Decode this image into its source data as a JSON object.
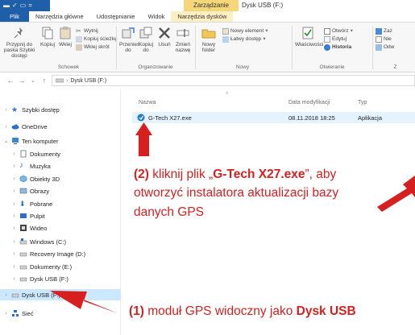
{
  "titlebar": {
    "qat_items": [
      "▬",
      "✓",
      "▭",
      "="
    ],
    "context_tab": "Zarządzanie",
    "window_title": "Dysk USB (F:)"
  },
  "tabs": [
    "Plik",
    "Narzędzia główne",
    "Udostępnianie",
    "Widok",
    "Narzędzia dysków"
  ],
  "ribbon": {
    "pin_label": "Przypnij do paska Szybki dostęp",
    "copy_label": "Kopiuj",
    "paste_label": "Wklej",
    "cut_label": "Wytnij",
    "copy_path_label": "Kopiuj ścieżkę",
    "paste_shortcut_label": "Wklej skrót",
    "move_to_label": "Przenieś do",
    "copy_to_label": "Kopiuj do",
    "delete_label": "Usuń",
    "rename_label": "Zmień nazwę",
    "new_folder_label": "Nowy folder",
    "new_item_label": "Nowy element",
    "easy_access_label": "Łatwy dostęp",
    "properties_label": "Właściwości",
    "open_label": "Otwórz",
    "edit_label": "Edytuj",
    "history_label": "Historia",
    "cut_off_1": "Zaz",
    "cut_off_2": "Nie",
    "cut_off_3": "Odw",
    "groups": [
      "Schowek",
      "Organizowanie",
      "Nowy",
      "Otwieranie",
      "Z"
    ]
  },
  "address": {
    "back": "←",
    "forward": "→",
    "up": "↑",
    "path": "Dysk USB (F:)"
  },
  "nav": {
    "items": [
      {
        "label": "Szybki dostęp"
      },
      {
        "label": "OneDrive"
      },
      {
        "label": "Ten komputer"
      },
      {
        "label": "Dokumenty"
      },
      {
        "label": "Muzyka"
      },
      {
        "label": "Obiekty 3D"
      },
      {
        "label": "Obrazy"
      },
      {
        "label": "Pobrane"
      },
      {
        "label": "Pulpit"
      },
      {
        "label": "Wideo"
      },
      {
        "label": "Windows (C:)"
      },
      {
        "label": "Recovery Image (D:)"
      },
      {
        "label": "Dokumenty (E:)"
      },
      {
        "label": "Dysk USB (F:)"
      },
      {
        "label": "Dysk USB (F:)"
      },
      {
        "label": "Sieć"
      }
    ]
  },
  "columns": {
    "name": "Nazwa",
    "modified": "Data modyfikacji",
    "type": "Typ"
  },
  "file": {
    "name": "G-Tech X27.exe",
    "modified": "08.11.2018 18:25",
    "type": "Aplikacja"
  },
  "annotations": {
    "step2_num": "(2)",
    "step2_a": " kliknij plik „",
    "step2_file": "G-Tech X27.exe",
    "step2_b": "”, aby",
    "step2_line2": "otworzyć instalatora aktualizacji bazy",
    "step2_line3": "danych GPS",
    "step1_num": "(1)",
    "step1_text": " moduł GPS widoczny jako ",
    "step1_bold": "Dysk USB"
  },
  "colors": {
    "annotation_red": "#d81f1f",
    "file_tab_blue": "#1f5ea8",
    "context_tab_yellow": "#f5d77a",
    "selection_blue": "#cce8ff"
  }
}
